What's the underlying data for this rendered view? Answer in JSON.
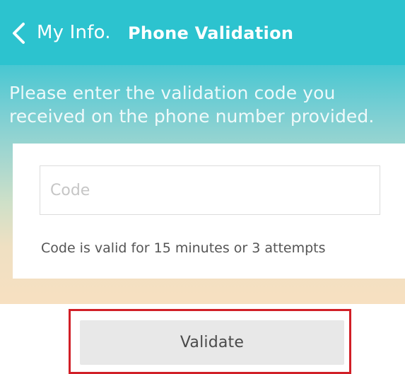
{
  "header": {
    "back_label": "My Info.",
    "title": "Phone Validation",
    "color": "#2cc3cf"
  },
  "instructions": {
    "line1": "Please enter the validation code you",
    "line2": "received on the phone number provided."
  },
  "form": {
    "code_value": "",
    "code_placeholder": "Code",
    "hint": "Code is valid for 15 minutes or 3 attempts"
  },
  "actions": {
    "validate_label": "Validate",
    "highlight_color": "#d11f27"
  },
  "icons": {
    "back": "chevron-left-icon"
  }
}
